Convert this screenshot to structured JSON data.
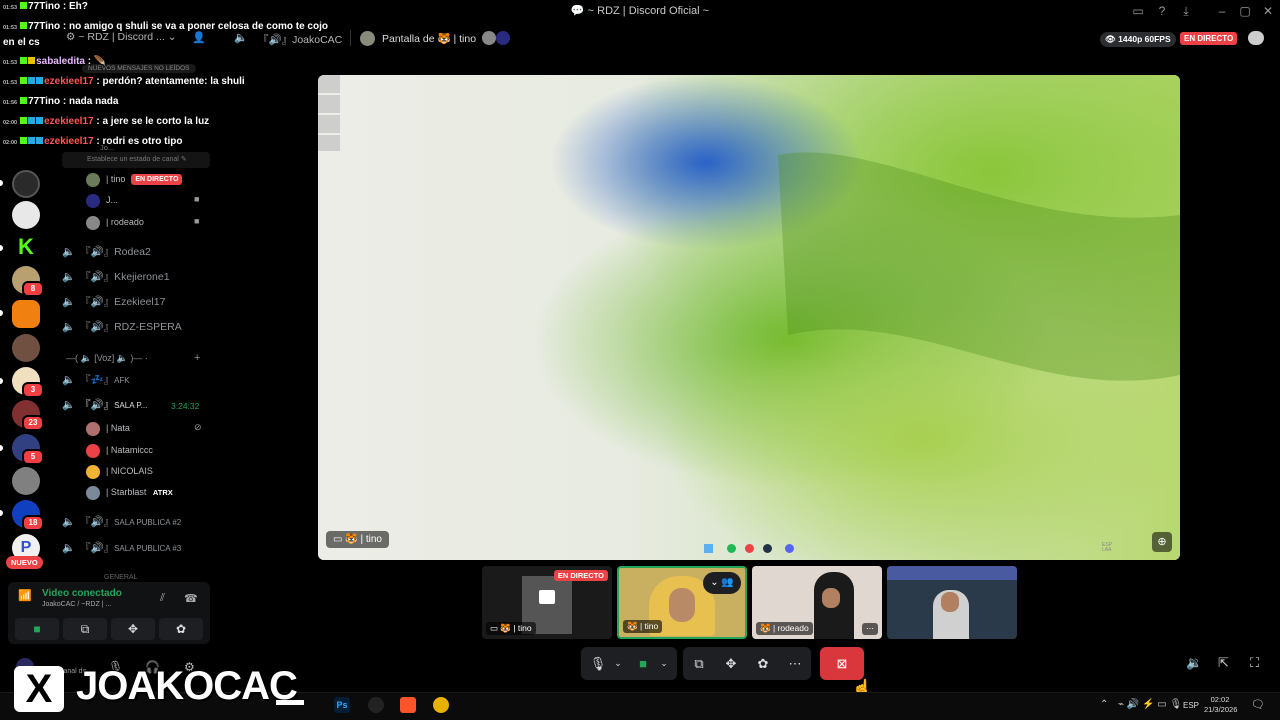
{
  "window": {
    "title": "~ RDZ | Discord Oficial ~"
  },
  "chat": [
    {
      "time": "01:53",
      "user": "77Tino",
      "sep": " : ",
      "text": "Eh?",
      "color": "#ffffff"
    },
    {
      "time": "01:53",
      "user": "77Tino",
      "sep": " : ",
      "text": "no amigo q shuli se va a poner celosa de como te cojo",
      "color": "#ffffff"
    },
    {
      "time": "",
      "user": "",
      "sep": "",
      "text": "en el cs",
      "color": "#ffffff"
    },
    {
      "time": "01:53",
      "user": "sabaledita",
      "sep": " : ",
      "text": "",
      "color": "#e6b8ff"
    },
    {
      "time": "01:53",
      "user": "ezekieel17",
      "sep": " : ",
      "text": "perdón? atentamente: la shuli",
      "color": "#ff5555"
    },
    {
      "time": "01:56",
      "user": "77Tino",
      "sep": " : ",
      "text": "nada nada",
      "color": "#ffffff"
    },
    {
      "time": "02:00",
      "user": "ezekieel17",
      "sep": " : ",
      "text": "a jere se le corto la luz",
      "color": "#ff5555"
    },
    {
      "time": "02:00",
      "user": "ezekieel17",
      "sep": " : ",
      "text": "rodri es otro tipo",
      "color": "#ff5555"
    }
  ],
  "server": {
    "name": "~ RDZ | Discord ...",
    "unread_banner": "NUEVOS MENSAJES NO LEÍDOS",
    "channel_status_hint": "Establece un estado de canal",
    "top_item": "Jo..."
  },
  "rail": {
    "badges": [
      "8",
      "3",
      "23",
      "5",
      "18"
    ],
    "new_label": "NUEVO"
  },
  "channels": {
    "live_users": [
      {
        "name": "| tino",
        "live": "EN DIRECTO"
      },
      {
        "name": "J...",
        "live": ""
      },
      {
        "name": "| rodeado",
        "live": ""
      }
    ],
    "voice_list": [
      "Rodea2",
      "Kkejierone1",
      "Ezekieel17",
      "RDZ-ESPERA"
    ],
    "category": "—( 🔈 [Voz] 🔈 )— ·",
    "afk": "AFK",
    "sala_p": {
      "name": "SALA P...",
      "timer": "3:24:32"
    },
    "sala_p_users": [
      "| Nata",
      "| Natamiccc",
      "| NICOLAIS",
      "| Starblast"
    ],
    "atrx_tag": "ATRX",
    "salas": [
      "SALA PUBLICA #2",
      "SALA PUBLICA #3"
    ],
    "general": "GENERAL"
  },
  "voice_panel": {
    "status": "Video conectado",
    "channel": "JoakoCAC / ~RDZ | ...",
    "user_hint": "canal de..."
  },
  "header": {
    "channel": "JoakoCAC",
    "screen_of": "Pantalla de",
    "screen_user": "| tino",
    "resolution": "1440p 60FPS",
    "live": "EN DIRECTO"
  },
  "stream": {
    "label": "| tino",
    "tray_lang": "ESP\nLAA"
  },
  "tiles": [
    {
      "label": "| tino",
      "live": "EN DIRECTO"
    },
    {
      "label": "| tino",
      "live": ""
    },
    {
      "label": "| rodeado",
      "live": ""
    },
    {
      "label": "",
      "live": ""
    }
  ],
  "taskbar": {
    "lang": "ESP",
    "time": "02:02",
    "date": "21/3/2026"
  },
  "overlay": {
    "x": "X",
    "brand": "JOAKOCAC"
  }
}
